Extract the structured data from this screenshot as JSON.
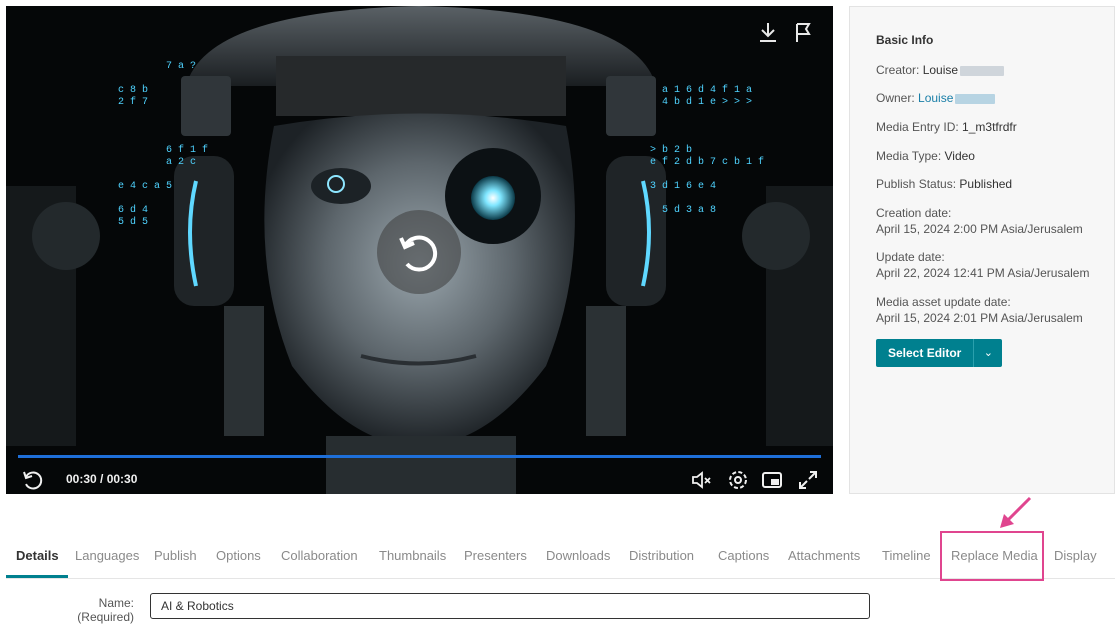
{
  "player": {
    "time_display": "00:30 / 00:30",
    "icons": [
      "download-icon",
      "flag-icon",
      "replay-icon",
      "mute-icon",
      "settings-icon",
      "pip-icon",
      "fullscreen-icon"
    ],
    "progress_fraction": 1.0,
    "progress_color": "#1e6fd9"
  },
  "info": {
    "title": "Basic Info",
    "creator_label": "Creator:",
    "creator_value": "Louise",
    "owner_label": "Owner:",
    "owner_value": "Louise",
    "entry_id_label": "Media Entry ID:",
    "entry_id_value": "1_m3tfrdfr",
    "media_type_label": "Media Type:",
    "media_type_value": "Video",
    "publish_status_label": "Publish Status:",
    "publish_status_value": "Published",
    "creation_label": "Creation date:",
    "creation_value": "April 15, 2024 2:00 PM Asia/Jerusalem",
    "update_label": "Update date:",
    "update_value": "April 22, 2024 12:41 PM Asia/Jerusalem",
    "asset_update_label": "Media asset update date:",
    "asset_update_value": "April 15, 2024 2:01 PM Asia/Jerusalem",
    "editor_button": "Select Editor",
    "accent_color": "#00808f"
  },
  "tabs": [
    {
      "label": "Details",
      "active": true
    },
    {
      "label": "Languages"
    },
    {
      "label": "Publish"
    },
    {
      "label": "Options"
    },
    {
      "label": "Collaboration"
    },
    {
      "label": "Thumbnails"
    },
    {
      "label": "Presenters"
    },
    {
      "label": "Downloads"
    },
    {
      "label": "Distribution"
    },
    {
      "label": "Captions"
    },
    {
      "label": "Attachments"
    },
    {
      "label": "Timeline"
    },
    {
      "label": "Replace Media"
    },
    {
      "label": "Display"
    }
  ],
  "highlight_color": "#e0458f",
  "form": {
    "name_label": "Name:",
    "name_required": "(Required)",
    "name_value": "AI & Robotics"
  }
}
